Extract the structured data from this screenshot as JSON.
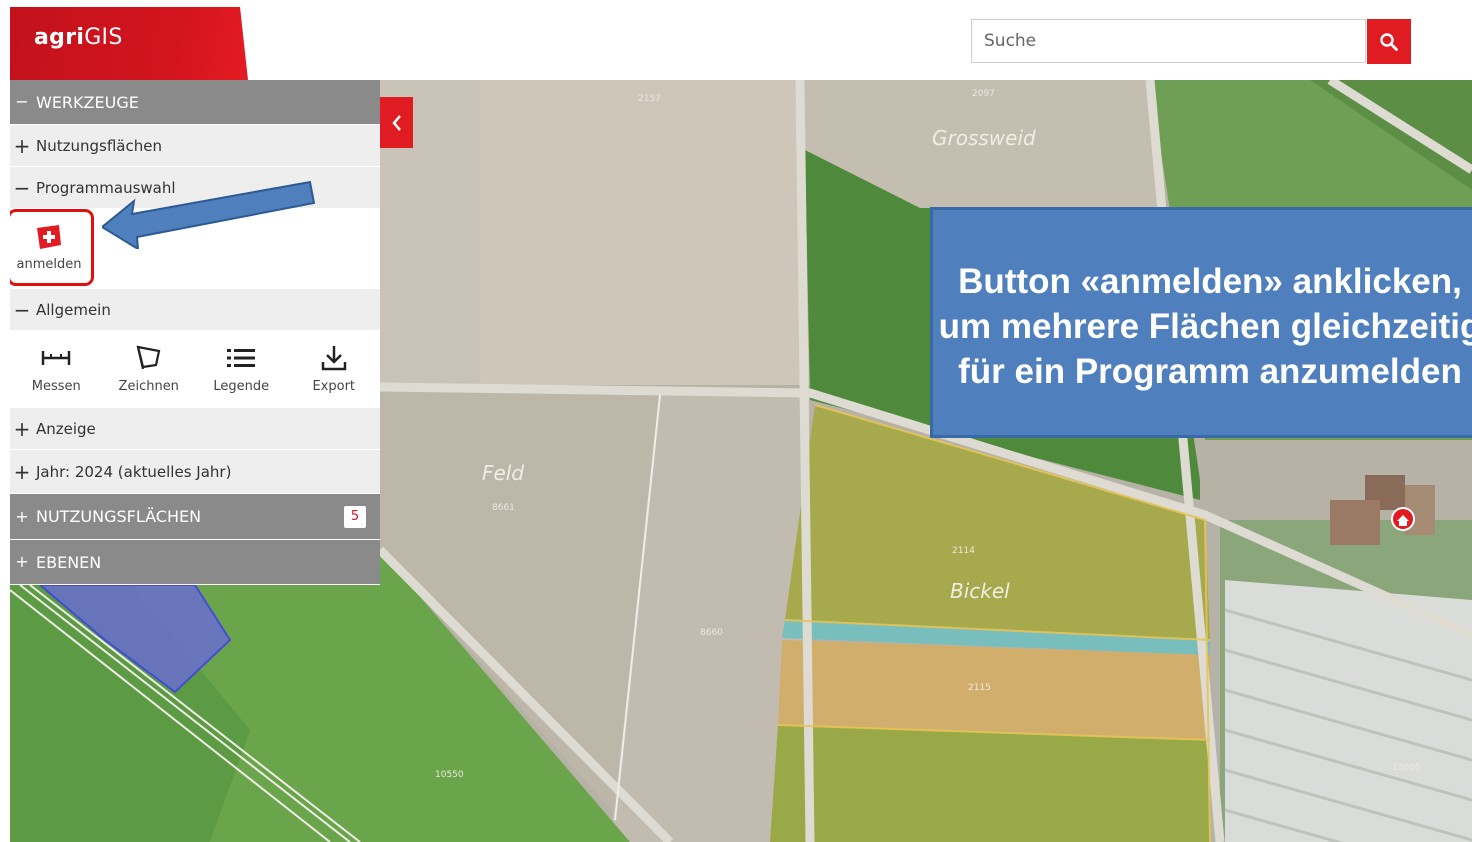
{
  "header": {
    "brand_bold": "agri",
    "brand_rest": "GIS",
    "search_placeholder": "Suche"
  },
  "sidebar": {
    "werkzeuge": {
      "sign": "−",
      "label": "WERKZEUGE"
    },
    "nutzungsflaechen_sub": {
      "sign": "+",
      "label": "Nutzungsflächen"
    },
    "programmauswahl": {
      "sign": "−",
      "label": "Programmauswahl"
    },
    "anmelden_label": "anmelden",
    "allgemein": {
      "sign": "−",
      "label": "Allgemein"
    },
    "tools": [
      {
        "label": "Messen",
        "icon": "measure-icon"
      },
      {
        "label": "Zeichnen",
        "icon": "draw-icon"
      },
      {
        "label": "Legende",
        "icon": "legend-icon"
      },
      {
        "label": "Export",
        "icon": "export-icon"
      }
    ],
    "anzeige": {
      "sign": "+",
      "label": "Anzeige"
    },
    "jahr": {
      "sign": "+",
      "label": "Jahr: 2024 (aktuelles Jahr)"
    },
    "nutzungsflaechen": {
      "sign": "+",
      "label": "NUTZUNGSFLÄCHEN",
      "count": "5"
    },
    "ebenen": {
      "sign": "+",
      "label": "EBENEN"
    }
  },
  "map": {
    "places": [
      "Grossweid",
      "Feld",
      "Bickel"
    ],
    "parcels": [
      "2157",
      "2097",
      "8661",
      "8660",
      "2114",
      "2115",
      "10550",
      "13005"
    ]
  },
  "callout": {
    "line1": "Button «anmelden» anklicken,",
    "line2": "um mehrere Flächen gleichzeitig",
    "line3": "für ein Programm anzumelden"
  },
  "colors": {
    "brand_red": "#e01b22",
    "sidebar_header": "#8a8a8a",
    "callout_blue": "#4f7fbd"
  }
}
